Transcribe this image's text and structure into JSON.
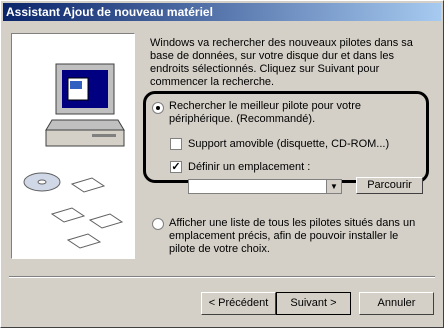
{
  "window": {
    "title": "Assistant Ajout de nouveau matériel"
  },
  "intro": "Windows va rechercher des nouveaux pilotes dans sa base de données, sur votre disque dur et dans les endroits sélectionnés. Cliquez sur Suivant pour commencer la recherche.",
  "options": {
    "search_best": "Rechercher le meilleur pilote pour votre périphérique. (Recommandé).",
    "removable": "Support amovible (disquette, CD-ROM...)",
    "specify_location": "Définir un emplacement :",
    "list_all": "Afficher une liste de tous les pilotes situés dans un emplacement précis, afin de pouvoir installer le pilote de votre choix."
  },
  "location": {
    "value": ""
  },
  "buttons": {
    "browse": "Parcourir",
    "back": "< Précédent",
    "next": "Suivant >",
    "cancel": "Annuler"
  },
  "icons": [
    "computer-icon",
    "cd-icon",
    "floppy-icon"
  ],
  "colors": {
    "titlebar_start": "#0a246a",
    "titlebar_end": "#a6caf0",
    "face": "#d4d0c8"
  }
}
